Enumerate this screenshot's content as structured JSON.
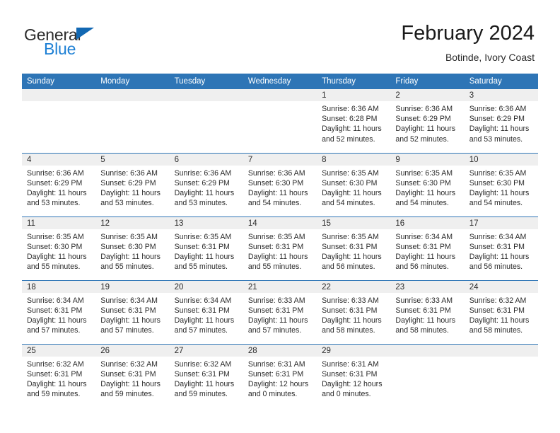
{
  "brand": {
    "name_part1": "General",
    "name_part2": "Blue",
    "triangle_color": "#1268b3"
  },
  "header": {
    "title": "February 2024",
    "subtitle": "Botinde, Ivory Coast"
  },
  "colors": {
    "header_blue": "#2e75b6",
    "daynum_band": "#efefef",
    "text": "#2b2b2b"
  },
  "weekday_headers": [
    "Sunday",
    "Monday",
    "Tuesday",
    "Wednesday",
    "Thursday",
    "Friday",
    "Saturday"
  ],
  "weeks": [
    [
      {
        "day": "",
        "lines": []
      },
      {
        "day": "",
        "lines": []
      },
      {
        "day": "",
        "lines": []
      },
      {
        "day": "",
        "lines": []
      },
      {
        "day": "1",
        "lines": [
          "Sunrise: 6:36 AM",
          "Sunset: 6:28 PM",
          "Daylight: 11 hours",
          "and 52 minutes."
        ]
      },
      {
        "day": "2",
        "lines": [
          "Sunrise: 6:36 AM",
          "Sunset: 6:29 PM",
          "Daylight: 11 hours",
          "and 52 minutes."
        ]
      },
      {
        "day": "3",
        "lines": [
          "Sunrise: 6:36 AM",
          "Sunset: 6:29 PM",
          "Daylight: 11 hours",
          "and 53 minutes."
        ]
      }
    ],
    [
      {
        "day": "4",
        "lines": [
          "Sunrise: 6:36 AM",
          "Sunset: 6:29 PM",
          "Daylight: 11 hours",
          "and 53 minutes."
        ]
      },
      {
        "day": "5",
        "lines": [
          "Sunrise: 6:36 AM",
          "Sunset: 6:29 PM",
          "Daylight: 11 hours",
          "and 53 minutes."
        ]
      },
      {
        "day": "6",
        "lines": [
          "Sunrise: 6:36 AM",
          "Sunset: 6:29 PM",
          "Daylight: 11 hours",
          "and 53 minutes."
        ]
      },
      {
        "day": "7",
        "lines": [
          "Sunrise: 6:36 AM",
          "Sunset: 6:30 PM",
          "Daylight: 11 hours",
          "and 54 minutes."
        ]
      },
      {
        "day": "8",
        "lines": [
          "Sunrise: 6:35 AM",
          "Sunset: 6:30 PM",
          "Daylight: 11 hours",
          "and 54 minutes."
        ]
      },
      {
        "day": "9",
        "lines": [
          "Sunrise: 6:35 AM",
          "Sunset: 6:30 PM",
          "Daylight: 11 hours",
          "and 54 minutes."
        ]
      },
      {
        "day": "10",
        "lines": [
          "Sunrise: 6:35 AM",
          "Sunset: 6:30 PM",
          "Daylight: 11 hours",
          "and 54 minutes."
        ]
      }
    ],
    [
      {
        "day": "11",
        "lines": [
          "Sunrise: 6:35 AM",
          "Sunset: 6:30 PM",
          "Daylight: 11 hours",
          "and 55 minutes."
        ]
      },
      {
        "day": "12",
        "lines": [
          "Sunrise: 6:35 AM",
          "Sunset: 6:30 PM",
          "Daylight: 11 hours",
          "and 55 minutes."
        ]
      },
      {
        "day": "13",
        "lines": [
          "Sunrise: 6:35 AM",
          "Sunset: 6:31 PM",
          "Daylight: 11 hours",
          "and 55 minutes."
        ]
      },
      {
        "day": "14",
        "lines": [
          "Sunrise: 6:35 AM",
          "Sunset: 6:31 PM",
          "Daylight: 11 hours",
          "and 55 minutes."
        ]
      },
      {
        "day": "15",
        "lines": [
          "Sunrise: 6:35 AM",
          "Sunset: 6:31 PM",
          "Daylight: 11 hours",
          "and 56 minutes."
        ]
      },
      {
        "day": "16",
        "lines": [
          "Sunrise: 6:34 AM",
          "Sunset: 6:31 PM",
          "Daylight: 11 hours",
          "and 56 minutes."
        ]
      },
      {
        "day": "17",
        "lines": [
          "Sunrise: 6:34 AM",
          "Sunset: 6:31 PM",
          "Daylight: 11 hours",
          "and 56 minutes."
        ]
      }
    ],
    [
      {
        "day": "18",
        "lines": [
          "Sunrise: 6:34 AM",
          "Sunset: 6:31 PM",
          "Daylight: 11 hours",
          "and 57 minutes."
        ]
      },
      {
        "day": "19",
        "lines": [
          "Sunrise: 6:34 AM",
          "Sunset: 6:31 PM",
          "Daylight: 11 hours",
          "and 57 minutes."
        ]
      },
      {
        "day": "20",
        "lines": [
          "Sunrise: 6:34 AM",
          "Sunset: 6:31 PM",
          "Daylight: 11 hours",
          "and 57 minutes."
        ]
      },
      {
        "day": "21",
        "lines": [
          "Sunrise: 6:33 AM",
          "Sunset: 6:31 PM",
          "Daylight: 11 hours",
          "and 57 minutes."
        ]
      },
      {
        "day": "22",
        "lines": [
          "Sunrise: 6:33 AM",
          "Sunset: 6:31 PM",
          "Daylight: 11 hours",
          "and 58 minutes."
        ]
      },
      {
        "day": "23",
        "lines": [
          "Sunrise: 6:33 AM",
          "Sunset: 6:31 PM",
          "Daylight: 11 hours",
          "and 58 minutes."
        ]
      },
      {
        "day": "24",
        "lines": [
          "Sunrise: 6:32 AM",
          "Sunset: 6:31 PM",
          "Daylight: 11 hours",
          "and 58 minutes."
        ]
      }
    ],
    [
      {
        "day": "25",
        "lines": [
          "Sunrise: 6:32 AM",
          "Sunset: 6:31 PM",
          "Daylight: 11 hours",
          "and 59 minutes."
        ]
      },
      {
        "day": "26",
        "lines": [
          "Sunrise: 6:32 AM",
          "Sunset: 6:31 PM",
          "Daylight: 11 hours",
          "and 59 minutes."
        ]
      },
      {
        "day": "27",
        "lines": [
          "Sunrise: 6:32 AM",
          "Sunset: 6:31 PM",
          "Daylight: 11 hours",
          "and 59 minutes."
        ]
      },
      {
        "day": "28",
        "lines": [
          "Sunrise: 6:31 AM",
          "Sunset: 6:31 PM",
          "Daylight: 12 hours",
          "and 0 minutes."
        ]
      },
      {
        "day": "29",
        "lines": [
          "Sunrise: 6:31 AM",
          "Sunset: 6:31 PM",
          "Daylight: 12 hours",
          "and 0 minutes."
        ]
      },
      {
        "day": "",
        "lines": []
      },
      {
        "day": "",
        "lines": []
      }
    ]
  ]
}
